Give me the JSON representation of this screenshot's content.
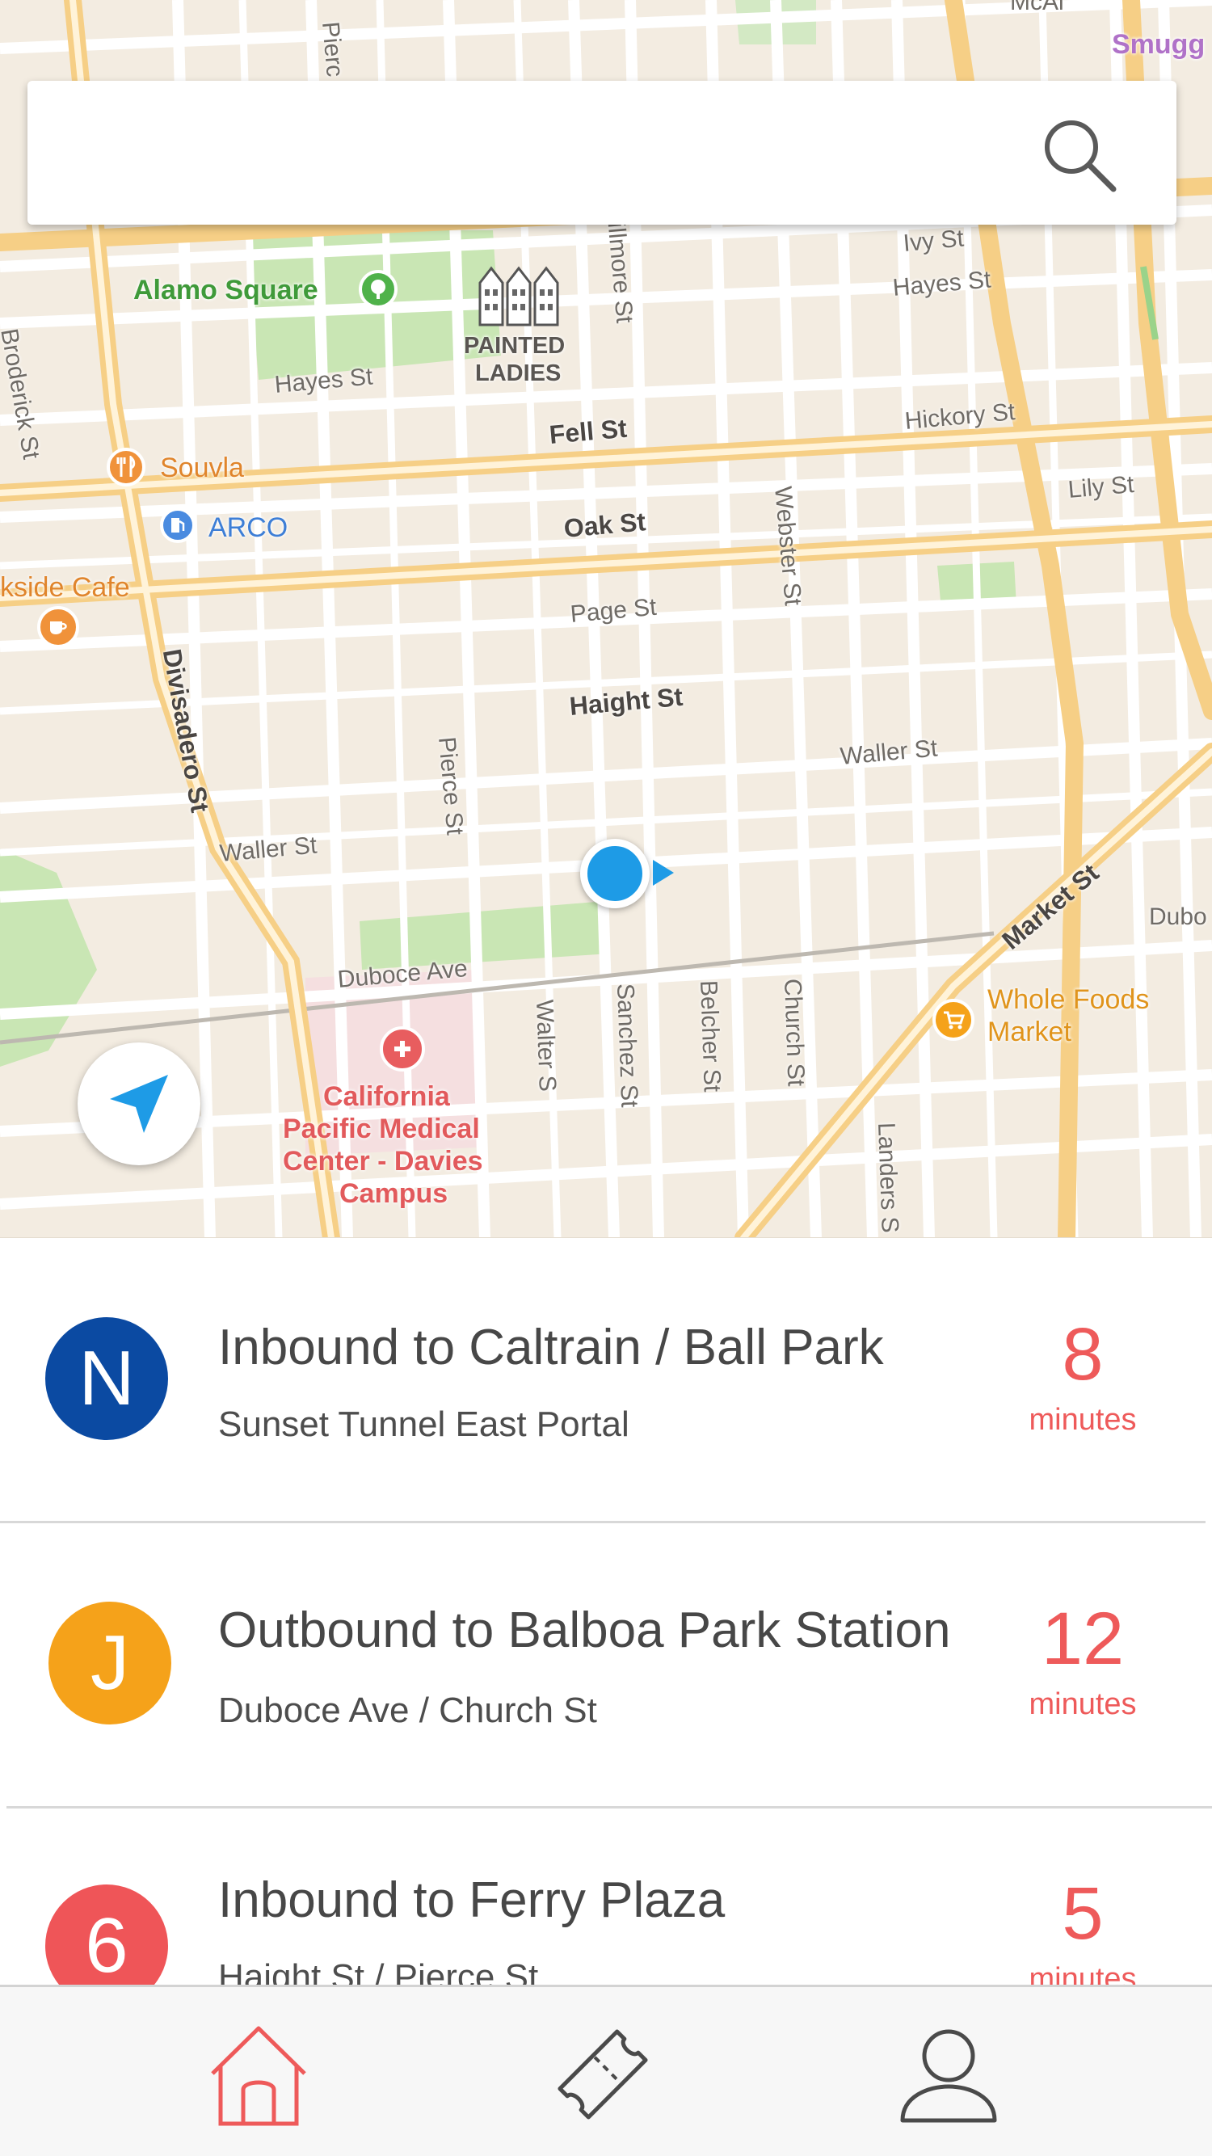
{
  "search": {
    "placeholder": "",
    "value": ""
  },
  "map": {
    "streets": {
      "ivy_st": "Ivy St",
      "hayes_st_east": "Hayes St",
      "hayes_st_west": "Hayes St",
      "hickory_st": "Hickory St",
      "lily_st": "Lily St",
      "fell_st": "Fell St",
      "oak_st": "Oak St",
      "page_st": "Page St",
      "haight_st": "Haight St",
      "waller_st_east": "Waller St",
      "waller_st_west": "Waller St",
      "duboce_ave": "Duboce Ave",
      "market_st": "Market St",
      "fillmore_st": "Fillmore St",
      "webster_st": "Webster St",
      "divisadero_st": "Divisadero St",
      "pierce_st": "Pierce St",
      "pierce_top": "Pierc",
      "broderick_st": "Broderick St",
      "walter_st": "Walter S",
      "sanchez_st": "Sanchez St",
      "belcher_st": "Belcher St",
      "church_st": "Church St",
      "landers_st": "Landers S",
      "dubo_partial": "Dubo"
    },
    "pois": {
      "alamo_square": "Alamo Square",
      "painted_ladies_1": "PAINTED",
      "painted_ladies_2": "LADIES",
      "souvla": "Souvla",
      "arco": "ARCO",
      "cafe": "kside Cafe",
      "whole_foods_1": "Whole Foods",
      "whole_foods_2": "Market",
      "hospital_1": "California",
      "hospital_2": "Pacific Medical",
      "hospital_3": "Center - Davies",
      "hospital_4": "Campus",
      "smugg": "Smugg",
      "top_partial": "McAl"
    }
  },
  "departures": [
    {
      "line": "N",
      "color": "#0b4aa2",
      "title": "Inbound to Caltrain / Ball Park",
      "stop": "Sunset Tunnel East Portal",
      "eta": "8",
      "eta_unit": "minutes"
    },
    {
      "line": "J",
      "color": "#f5a21a",
      "title": "Outbound to Balboa Park Station",
      "stop": "Duboce Ave / Church St",
      "eta": "12",
      "eta_unit": "minutes"
    },
    {
      "line": "6",
      "color": "#ef5558",
      "title": "Inbound to Ferry Plaza",
      "stop": "Haight St / Pierce St",
      "eta": "5",
      "eta_unit": "minutes"
    }
  ],
  "tabs": [
    {
      "icon": "home-icon",
      "active": true
    },
    {
      "icon": "ticket-icon",
      "active": false
    },
    {
      "icon": "profile-icon",
      "active": false
    }
  ],
  "colors": {
    "accent": "#ee5a5a",
    "location_blue": "#1e9be6",
    "park_green": "#c9e6b4"
  }
}
